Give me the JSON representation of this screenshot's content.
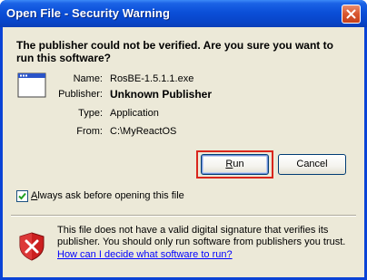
{
  "window": {
    "title": "Open File - Security Warning"
  },
  "dialog": {
    "headline": "The publisher could not be verified.  Are you sure you want to run this software?",
    "fields": [
      {
        "label": "Name:",
        "value": "RosBE-1.5.1.1.exe"
      },
      {
        "label": "Publisher:",
        "value": "Unknown Publisher"
      },
      {
        "label": "Type:",
        "value": "Application"
      },
      {
        "label": "From:",
        "value": "C:\\MyReactOS"
      }
    ],
    "run_label_prefix": "",
    "run_mnemonic": "R",
    "run_label_suffix": "un",
    "cancel_label": "Cancel",
    "checkbox": {
      "checked": true,
      "mnemonic": "A",
      "label_suffix": "lways ask before opening this file"
    },
    "warning_text": "This file does not have a valid digital signature that verifies its publisher.  You should only run software from publishers you trust.",
    "help_link": "How can I decide what software to run?"
  },
  "colors": {
    "title_bar": "#0b4fd8",
    "dialog_bg": "#ece9d8",
    "focus_highlight": "#d9261c",
    "link": "#0000ff",
    "shield_red": "#cc1f1f"
  },
  "icons": {
    "close": "close-icon",
    "app": "application-window-icon",
    "shield": "security-shield-icon",
    "check": "checkmark-icon"
  }
}
